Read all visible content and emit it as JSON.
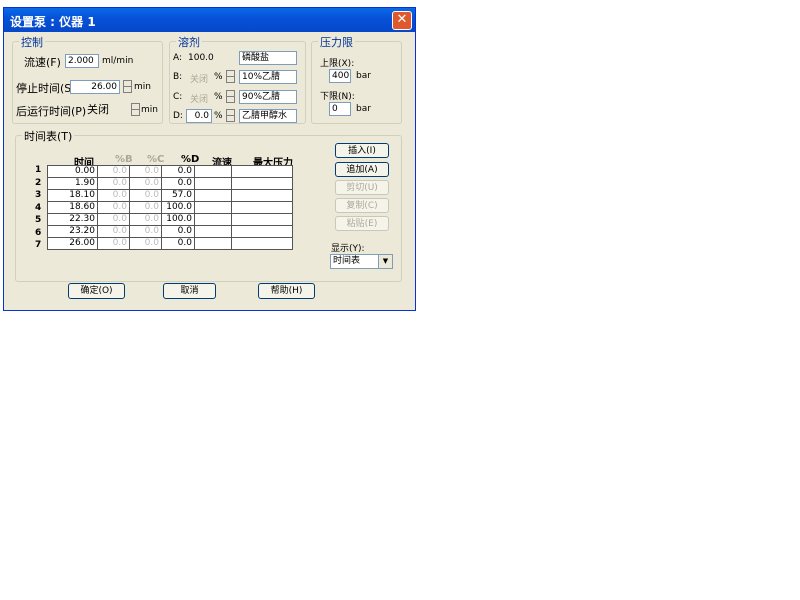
{
  "window": {
    "title": "设置泵 : 仪器 1",
    "close_glyph": "✕"
  },
  "control": {
    "label": "控制",
    "flow_label": "流速(F)",
    "flow_value": "2.000",
    "flow_unit": "ml/min",
    "stop_label": "停止时间(S)",
    "stop_value": "26.00",
    "stop_unit": "min",
    "post_label": "后运行时间(P)",
    "post_value": "关闭",
    "post_unit": "min"
  },
  "solvent": {
    "label": "溶剂",
    "a_label": "A:",
    "a_value": "100.0",
    "a_name": "磷酸盐",
    "b_label": "B:",
    "b_value": "关闭",
    "b_pct": "%",
    "b_name": "10%乙腈",
    "c_label": "C:",
    "c_value": "关闭",
    "c_pct": "%",
    "c_name": "90%乙腈",
    "d_label": "D:",
    "d_value": "0.0",
    "d_pct": "%",
    "d_name": "乙腈甲醇水"
  },
  "pressure": {
    "label": "压力限",
    "upper_label": "上限(X):",
    "upper_value": "400",
    "upper_unit": "bar",
    "lower_label": "下限(N):",
    "lower_value": "0",
    "lower_unit": "bar"
  },
  "timetable": {
    "label": "时间表(T)",
    "headers": [
      "时间",
      "%B",
      "%C",
      "%D",
      "流速",
      "最大压力"
    ],
    "rows": [
      {
        "n": "1",
        "time": "0.00",
        "b": "0.0",
        "c": "0.0",
        "d": "0.0",
        "flow": "",
        "pmax": ""
      },
      {
        "n": "2",
        "time": "1.90",
        "b": "0.0",
        "c": "0.0",
        "d": "0.0",
        "flow": "",
        "pmax": ""
      },
      {
        "n": "3",
        "time": "18.10",
        "b": "0.0",
        "c": "0.0",
        "d": "57.0",
        "flow": "",
        "pmax": ""
      },
      {
        "n": "4",
        "time": "18.60",
        "b": "0.0",
        "c": "0.0",
        "d": "100.0",
        "flow": "",
        "pmax": ""
      },
      {
        "n": "5",
        "time": "22.30",
        "b": "0.0",
        "c": "0.0",
        "d": "100.0",
        "flow": "",
        "pmax": ""
      },
      {
        "n": "6",
        "time": "23.20",
        "b": "0.0",
        "c": "0.0",
        "d": "0.0",
        "flow": "",
        "pmax": ""
      },
      {
        "n": "7",
        "time": "26.00",
        "b": "0.0",
        "c": "0.0",
        "d": "0.0",
        "flow": "",
        "pmax": ""
      }
    ],
    "insert_label": "插入(I)",
    "append_label": "追加(A)",
    "cut_label": "剪切(U)",
    "copy_label": "复制(C)",
    "paste_label": "粘贴(E)",
    "display_label": "显示(Y):",
    "display_value": "时间表"
  },
  "footer": {
    "ok_label": "确定(O)",
    "cancel_label": "取消",
    "help_label": "帮助(H)"
  }
}
